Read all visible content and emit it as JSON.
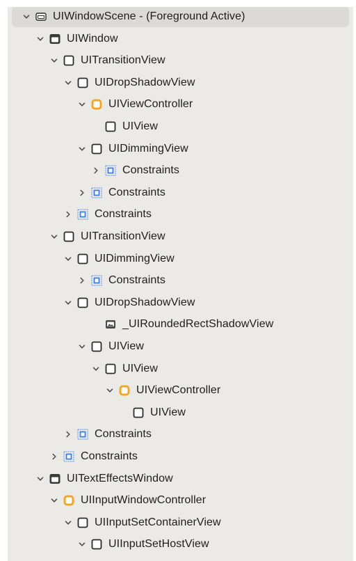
{
  "colors": {
    "panel_bg": "#ECEAE7",
    "selected_row_bg": "#DCDAD7",
    "view_icon_stroke": "#2b2b2b",
    "window_icon_fill": "#3a3a3a",
    "controller_icon": "#F3A624",
    "constraint_icon": "#3B7FE3",
    "text": "#1d1d1d"
  },
  "tree": [
    {
      "label": "UIWindowScene - (Foreground Active)",
      "depth": 0,
      "icon": "window-scene-icon",
      "expand": "expanded",
      "selected": true
    },
    {
      "label": "UIWindow",
      "depth": 1,
      "icon": "window-icon",
      "expand": "expanded"
    },
    {
      "label": "UITransitionView",
      "depth": 2,
      "icon": "view-icon",
      "expand": "expanded"
    },
    {
      "label": "UIDropShadowView",
      "depth": 3,
      "icon": "view-icon",
      "expand": "expanded"
    },
    {
      "label": "UIViewController",
      "depth": 4,
      "icon": "view-controller-icon",
      "expand": "expanded"
    },
    {
      "label": "UIView",
      "depth": 5,
      "icon": "view-icon",
      "expand": "none"
    },
    {
      "label": "UIDimmingView",
      "depth": 4,
      "icon": "view-icon",
      "expand": "expanded"
    },
    {
      "label": "Constraints",
      "depth": 5,
      "icon": "constraints-icon",
      "expand": "collapsed"
    },
    {
      "label": "Constraints",
      "depth": 4,
      "icon": "constraints-icon",
      "expand": "collapsed"
    },
    {
      "label": "Constraints",
      "depth": 3,
      "icon": "constraints-icon",
      "expand": "collapsed"
    },
    {
      "label": "UITransitionView",
      "depth": 2,
      "icon": "view-icon",
      "expand": "expanded"
    },
    {
      "label": "UIDimmingView",
      "depth": 3,
      "icon": "view-icon",
      "expand": "expanded"
    },
    {
      "label": "Constraints",
      "depth": 4,
      "icon": "constraints-icon",
      "expand": "collapsed"
    },
    {
      "label": "UIDropShadowView",
      "depth": 3,
      "icon": "view-icon",
      "expand": "expanded"
    },
    {
      "label": "_UIRoundedRectShadowView",
      "depth": 5,
      "icon": "image-view-icon",
      "expand": "none"
    },
    {
      "label": "UIView",
      "depth": 4,
      "icon": "view-icon",
      "expand": "expanded"
    },
    {
      "label": "UIView",
      "depth": 5,
      "icon": "view-icon",
      "expand": "expanded"
    },
    {
      "label": "UIViewController",
      "depth": 6,
      "icon": "view-controller-icon",
      "expand": "expanded"
    },
    {
      "label": "UIView",
      "depth": 7,
      "icon": "view-icon",
      "expand": "none"
    },
    {
      "label": "Constraints",
      "depth": 3,
      "icon": "constraints-icon",
      "expand": "collapsed"
    },
    {
      "label": "Constraints",
      "depth": 2,
      "icon": "constraints-icon",
      "expand": "collapsed"
    },
    {
      "label": "UITextEffectsWindow",
      "depth": 1,
      "icon": "window-icon",
      "expand": "expanded"
    },
    {
      "label": "UIInputWindowController",
      "depth": 2,
      "icon": "view-controller-icon",
      "expand": "expanded"
    },
    {
      "label": "UIInputSetContainerView",
      "depth": 3,
      "icon": "view-icon",
      "expand": "expanded"
    },
    {
      "label": "UIInputSetHostView",
      "depth": 4,
      "icon": "view-icon",
      "expand": "expanded"
    }
  ]
}
